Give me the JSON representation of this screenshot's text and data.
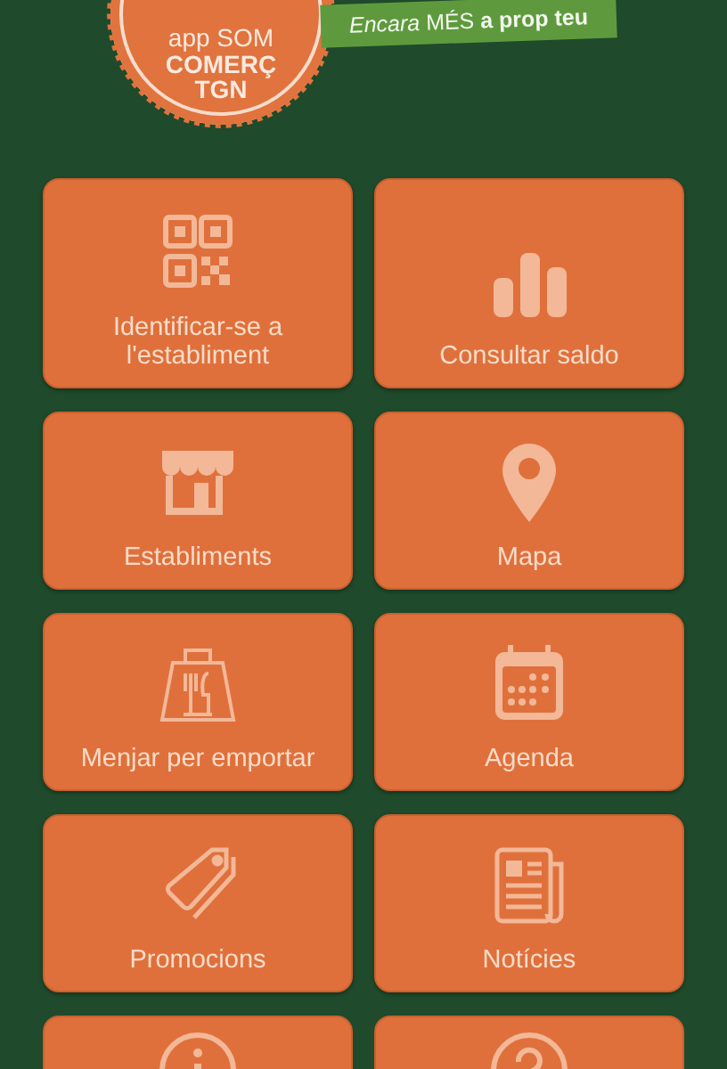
{
  "header": {
    "logo_lines": [
      "app SOM",
      "COMERÇ",
      "TGN"
    ],
    "slogan": "*Encara* MÉS **a prop teu**"
  },
  "tiles": [
    {
      "kind": "full",
      "label": "Identificar-se a l'establiment"
    },
    {
      "kind": "full",
      "label": "Consultar saldo"
    },
    {
      "kind": "full",
      "label": "Establiments"
    },
    {
      "kind": "full",
      "label": "Mapa"
    },
    {
      "kind": "full",
      "label": "Menjar per emportar"
    },
    {
      "kind": "full",
      "label": "Agenda"
    },
    {
      "kind": "full",
      "label": "Promocions"
    },
    {
      "kind": "full",
      "label": "Notícies"
    },
    {
      "kind": "cut"
    },
    {
      "kind": "cut"
    }
  ]
}
